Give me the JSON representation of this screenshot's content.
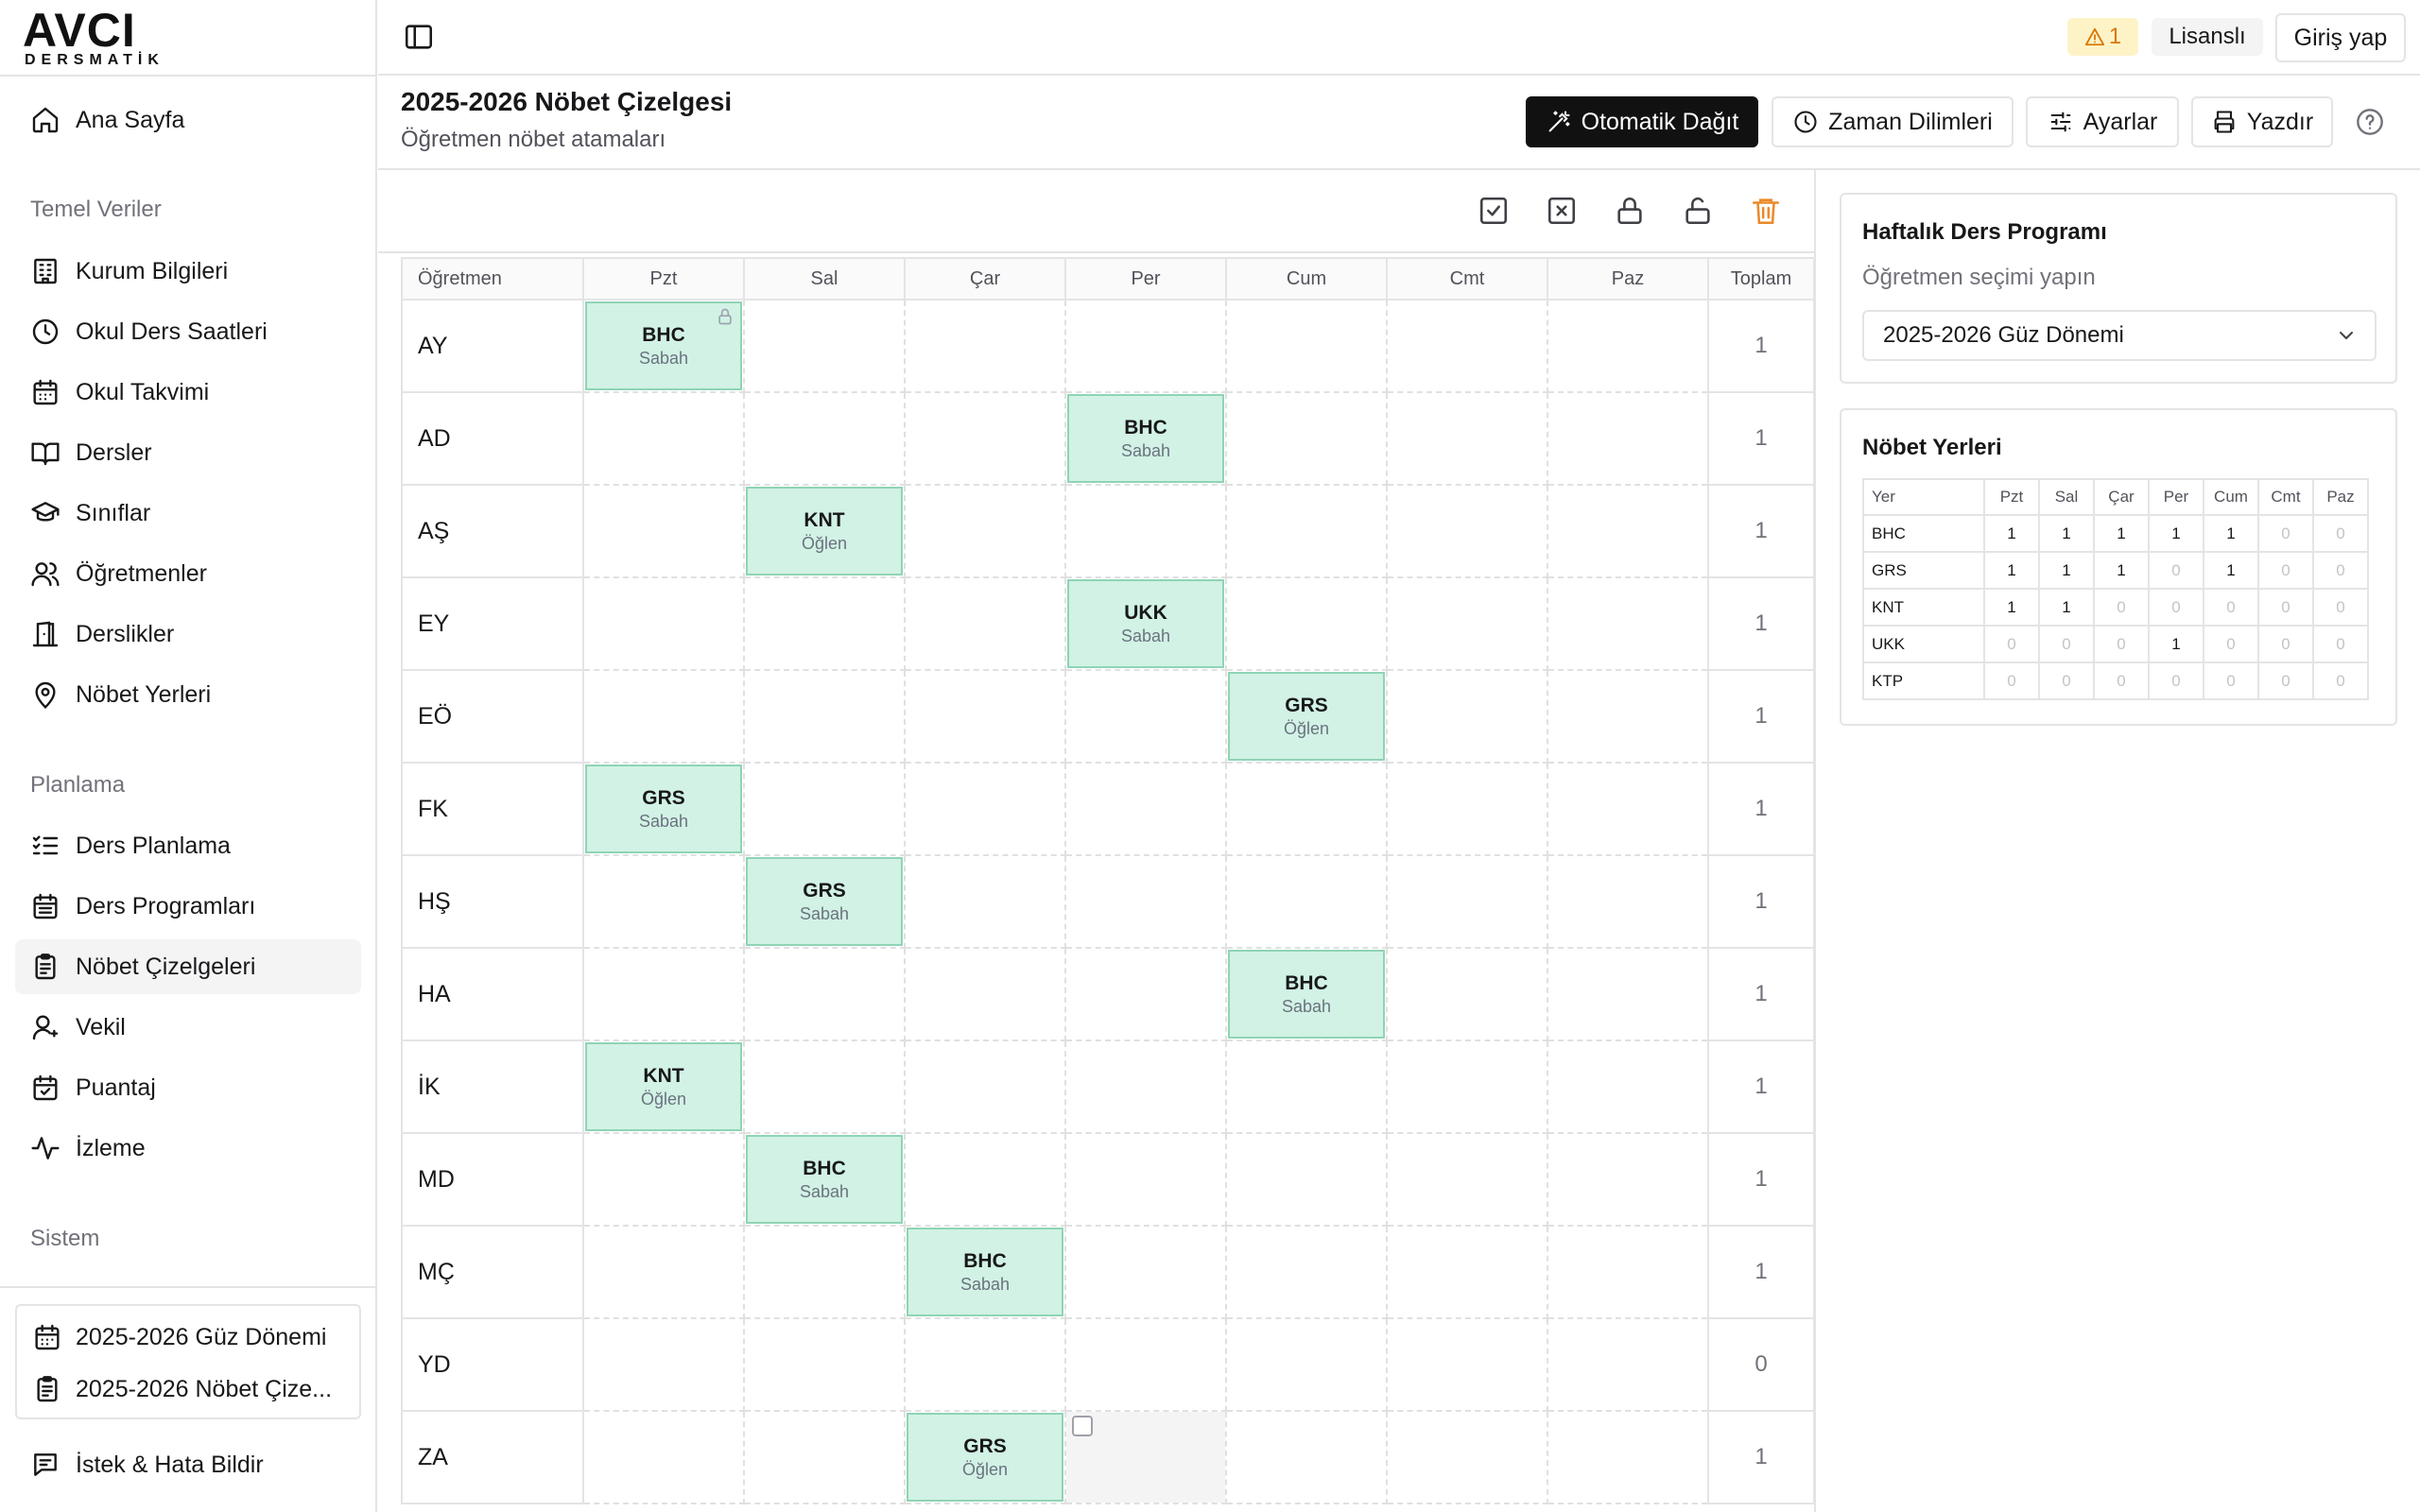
{
  "brand": {
    "name": "AVCI",
    "sub": "DERSMATİK"
  },
  "sidebar": {
    "home": "Ana Sayfa",
    "groups": {
      "temel": "Temel Veriler",
      "planlama": "Planlama",
      "sistem": "Sistem"
    },
    "temel_items": [
      {
        "label": "Kurum Bilgileri",
        "icon": "building-icon"
      },
      {
        "label": "Okul Ders Saatleri",
        "icon": "clock-icon"
      },
      {
        "label": "Okul Takvimi",
        "icon": "calendar-icon"
      },
      {
        "label": "Dersler",
        "icon": "book-open-icon"
      },
      {
        "label": "Sınıflar",
        "icon": "graduation-cap-icon"
      },
      {
        "label": "Öğretmenler",
        "icon": "users-icon"
      },
      {
        "label": "Derslikler",
        "icon": "door-icon"
      },
      {
        "label": "Nöbet Yerleri",
        "icon": "map-pin-icon"
      }
    ],
    "planlama_items": [
      {
        "label": "Ders Planlama",
        "icon": "list-check-icon"
      },
      {
        "label": "Ders Programları",
        "icon": "calendar-grid-icon"
      },
      {
        "label": "Nöbet Çizelgeleri",
        "icon": "clipboard-icon",
        "active": true
      },
      {
        "label": "Vekil",
        "icon": "user-icon"
      },
      {
        "label": "Puantaj",
        "icon": "calendar-check-icon"
      },
      {
        "label": "İzleme",
        "icon": "activity-icon"
      }
    ],
    "session": {
      "term": "2025-2026 Güz Dönemi",
      "schedule": "2025-2026 Nöbet Çize..."
    },
    "feedback": "İstek & Hata Bildir"
  },
  "topbar": {
    "warning_count": "1",
    "license": "Lisanslı",
    "login": "Giriş yap"
  },
  "header": {
    "title": "2025-2026 Nöbet Çizelgesi",
    "subtitle": "Öğretmen nöbet atamaları",
    "buttons": {
      "auto": "Otomatik Dağıt",
      "time_slots": "Zaman Dilimleri",
      "settings": "Ayarlar",
      "print": "Yazdır"
    }
  },
  "schedule": {
    "columns": [
      "Öğretmen",
      "Pzt",
      "Sal",
      "Çar",
      "Per",
      "Cum",
      "Cmt",
      "Paz",
      "Toplam"
    ],
    "rows": [
      {
        "teacher": "AY",
        "total": "1",
        "duties": [
          {
            "day": 0,
            "code": "BHC",
            "slot": "Sabah",
            "locked": true
          }
        ]
      },
      {
        "teacher": "AD",
        "total": "1",
        "duties": [
          {
            "day": 3,
            "code": "BHC",
            "slot": "Sabah"
          }
        ]
      },
      {
        "teacher": "AŞ",
        "total": "1",
        "duties": [
          {
            "day": 1,
            "code": "KNT",
            "slot": "Öğlen"
          }
        ]
      },
      {
        "teacher": "EY",
        "total": "1",
        "duties": [
          {
            "day": 3,
            "code": "UKK",
            "slot": "Sabah"
          }
        ]
      },
      {
        "teacher": "EÖ",
        "total": "1",
        "duties": [
          {
            "day": 4,
            "code": "GRS",
            "slot": "Öğlen"
          }
        ]
      },
      {
        "teacher": "FK",
        "total": "1",
        "duties": [
          {
            "day": 0,
            "code": "GRS",
            "slot": "Sabah"
          }
        ]
      },
      {
        "teacher": "HŞ",
        "total": "1",
        "duties": [
          {
            "day": 1,
            "code": "GRS",
            "slot": "Sabah"
          }
        ]
      },
      {
        "teacher": "HA",
        "total": "1",
        "duties": [
          {
            "day": 4,
            "code": "BHC",
            "slot": "Sabah"
          }
        ]
      },
      {
        "teacher": "İK",
        "total": "1",
        "duties": [
          {
            "day": 0,
            "code": "KNT",
            "slot": "Öğlen"
          }
        ]
      },
      {
        "teacher": "MD",
        "total": "1",
        "duties": [
          {
            "day": 1,
            "code": "BHC",
            "slot": "Sabah"
          }
        ]
      },
      {
        "teacher": "MÇ",
        "total": "1",
        "duties": [
          {
            "day": 2,
            "code": "BHC",
            "slot": "Sabah"
          }
        ]
      },
      {
        "teacher": "YD",
        "total": "0",
        "duties": []
      },
      {
        "teacher": "ZA",
        "total": "1",
        "duties": [
          {
            "day": 2,
            "code": "GRS",
            "slot": "Öğlen"
          }
        ],
        "selected_empty_day": 3
      }
    ]
  },
  "weekly_card": {
    "title": "Haftalık Ders Programı",
    "subtitle": "Öğretmen seçimi yapın",
    "selected_term": "2025-2026 Güz Dönemi"
  },
  "duty_places": {
    "title": "Nöbet Yerleri",
    "columns": [
      "Yer",
      "Pzt",
      "Sal",
      "Çar",
      "Per",
      "Cum",
      "Cmt",
      "Paz"
    ],
    "rows": [
      {
        "place": "BHC",
        "counts": [
          1,
          1,
          1,
          1,
          1,
          0,
          0
        ]
      },
      {
        "place": "GRS",
        "counts": [
          1,
          1,
          1,
          0,
          1,
          0,
          0
        ]
      },
      {
        "place": "KNT",
        "counts": [
          1,
          1,
          0,
          0,
          0,
          0,
          0
        ]
      },
      {
        "place": "UKK",
        "counts": [
          0,
          0,
          0,
          1,
          0,
          0,
          0
        ]
      },
      {
        "place": "KTP",
        "counts": [
          0,
          0,
          0,
          0,
          0,
          0,
          0
        ]
      }
    ]
  },
  "colors": {
    "duty_fill": "#d1f2e4",
    "duty_border": "#8fd4b5",
    "warning": "#d97706",
    "delete": "#ea8a2a",
    "primary": "#111111"
  }
}
